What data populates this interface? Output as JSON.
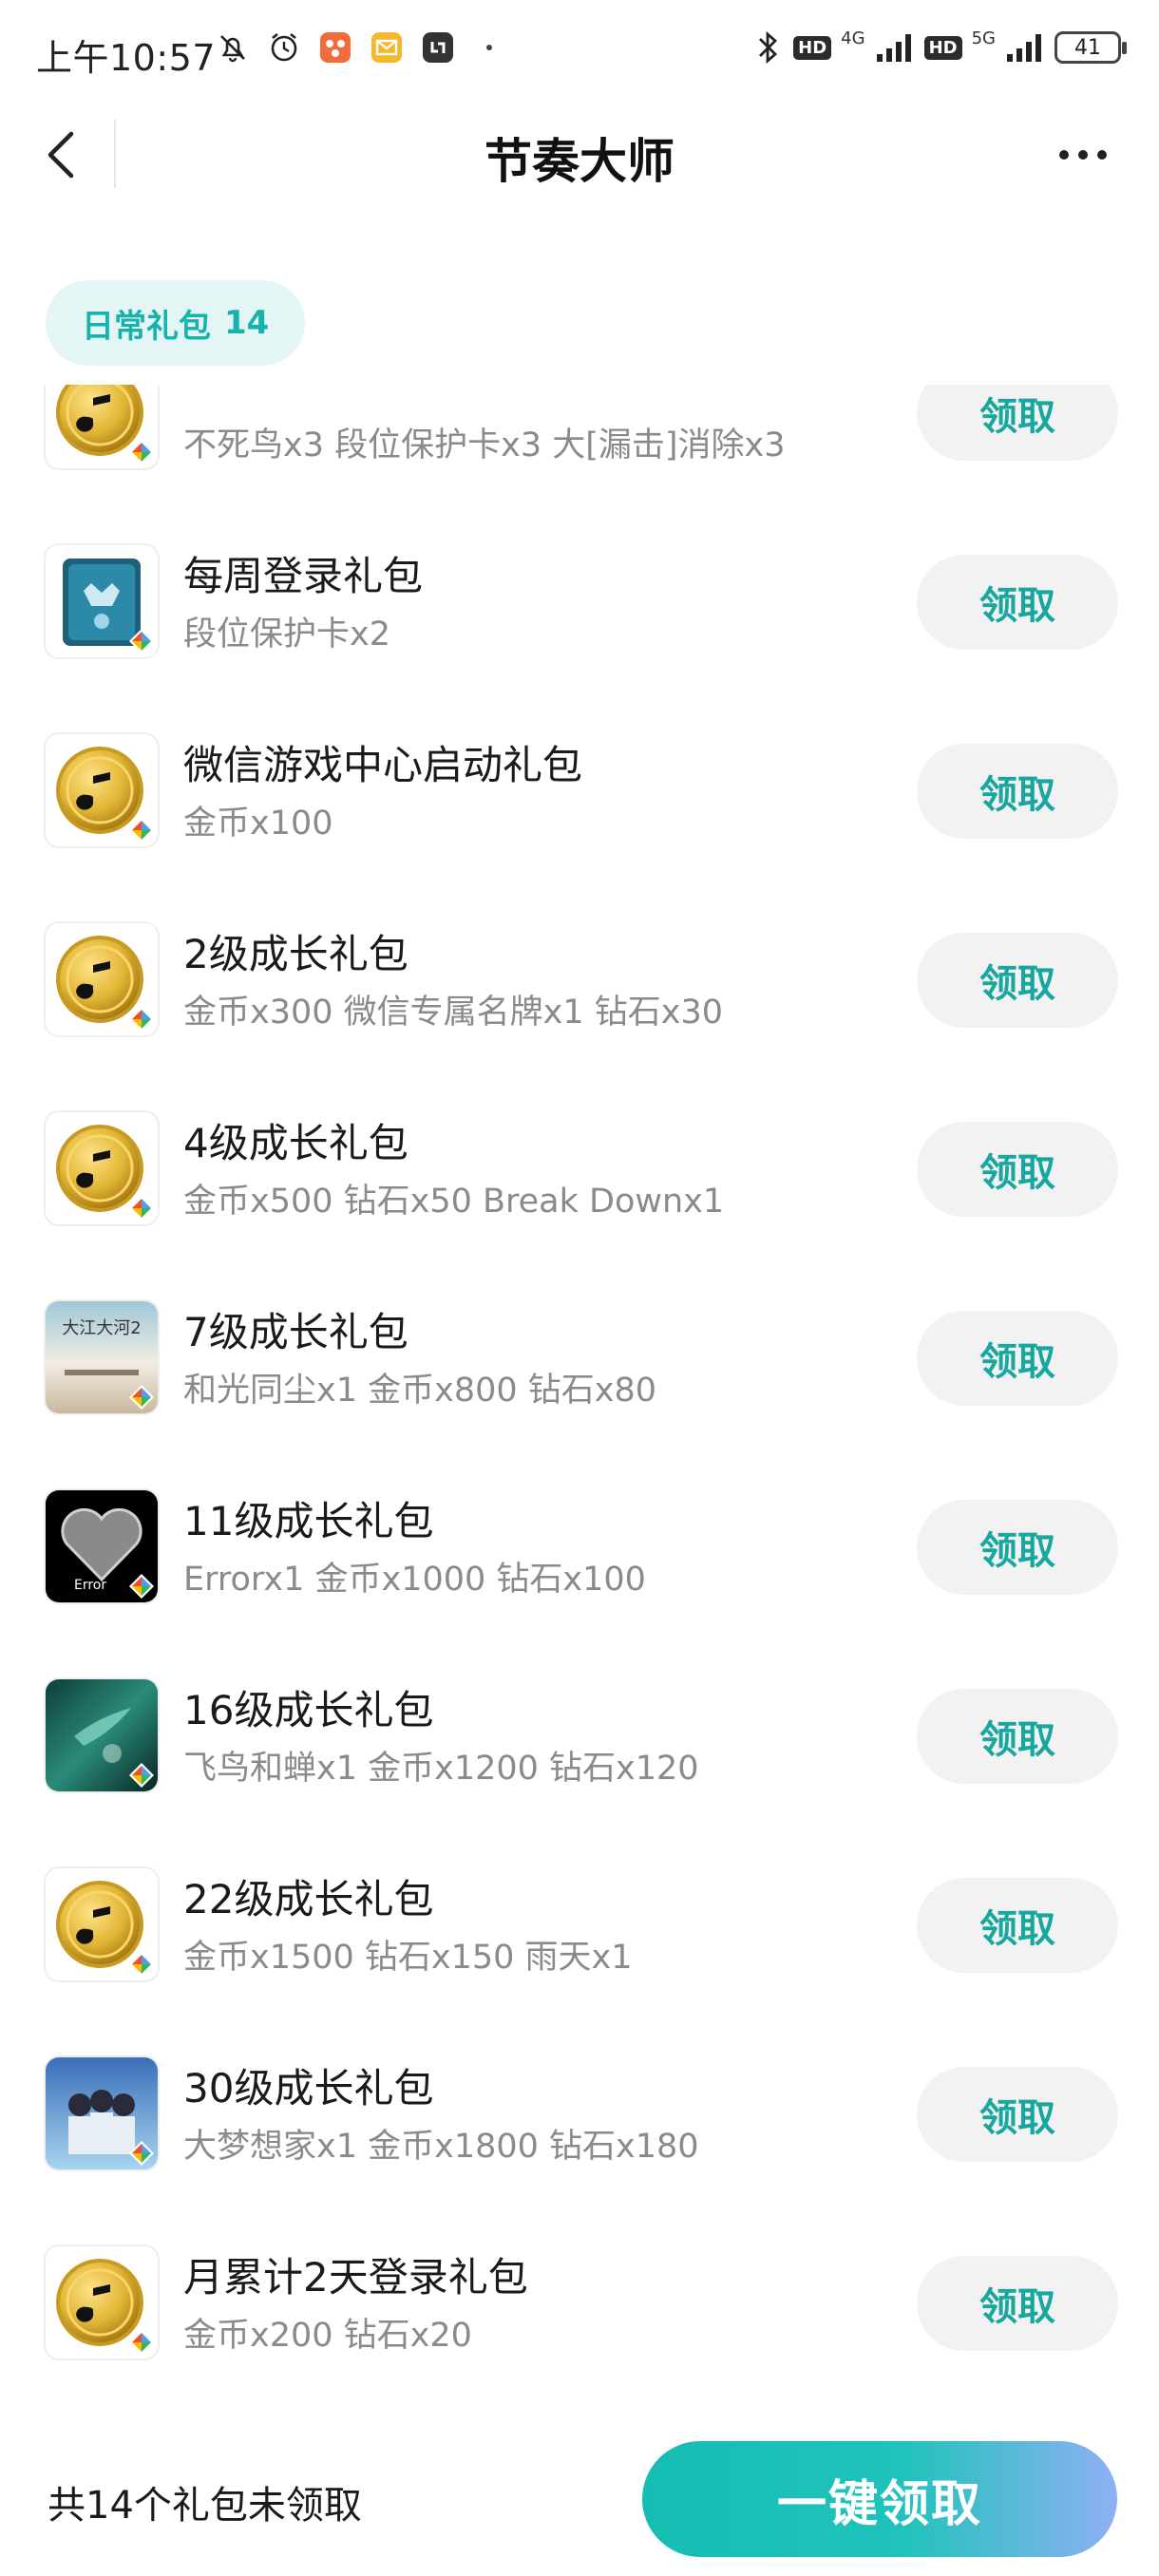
{
  "status_bar": {
    "time": "上午10:57",
    "network_1": "4G",
    "network_2": "5G",
    "hd_label": "HD",
    "battery": "41"
  },
  "header": {
    "title": "节奏大师"
  },
  "tab": {
    "label": "日常礼包",
    "count": "14"
  },
  "gifts": [
    {
      "title": "",
      "desc": "不死鸟x3 段位保护卡x3 大[漏击]消除x3",
      "icon": "gold-coin-music-icon",
      "button": "领取"
    },
    {
      "title": "每周登录礼包",
      "desc": "段位保护卡x2",
      "icon": "rank-protection-card-icon",
      "button": "领取"
    },
    {
      "title": "微信游戏中心启动礼包",
      "desc": "金币x100",
      "icon": "gold-coin-music-icon",
      "button": "领取"
    },
    {
      "title": "2级成长礼包",
      "desc": "金币x300 微信专属名牌x1 钻石x30",
      "icon": "gold-coin-music-icon",
      "button": "领取"
    },
    {
      "title": "4级成长礼包",
      "desc": "金币x500 钻石x50 Break Downx1",
      "icon": "gold-coin-music-icon",
      "button": "领取"
    },
    {
      "title": "7级成长礼包",
      "desc": "和光同尘x1 金币x800 钻石x80",
      "icon": "song-cover-icon",
      "button": "领取"
    },
    {
      "title": "11级成长礼包",
      "desc": "Errorx1 金币x1000 钻石x100",
      "icon": "error-album-icon",
      "button": "领取"
    },
    {
      "title": "16级成长礼包",
      "desc": "飞鸟和蝉x1 金币x1200 钻石x120",
      "icon": "bird-album-icon",
      "button": "领取"
    },
    {
      "title": "22级成长礼包",
      "desc": "金币x1500 钻石x150 雨天x1",
      "icon": "gold-coin-music-icon",
      "button": "领取"
    },
    {
      "title": "30级成长礼包",
      "desc": "大梦想家x1 金币x1800 钻石x180",
      "icon": "group-album-icon",
      "button": "领取"
    },
    {
      "title": "月累计2天登录礼包",
      "desc": "金币x200 钻石x20",
      "icon": "gold-coin-music-icon",
      "button": "领取"
    },
    {
      "title": "",
      "desc": "",
      "icon": "gold-coin-music-icon",
      "button": ""
    }
  ],
  "footer": {
    "remaining": "共14个礼包未领取",
    "claim_all": "一键领取"
  },
  "colors": {
    "accent": "#17a79f",
    "tab_bg": "#e3f6f5",
    "button_bg": "#f2f2f2"
  }
}
